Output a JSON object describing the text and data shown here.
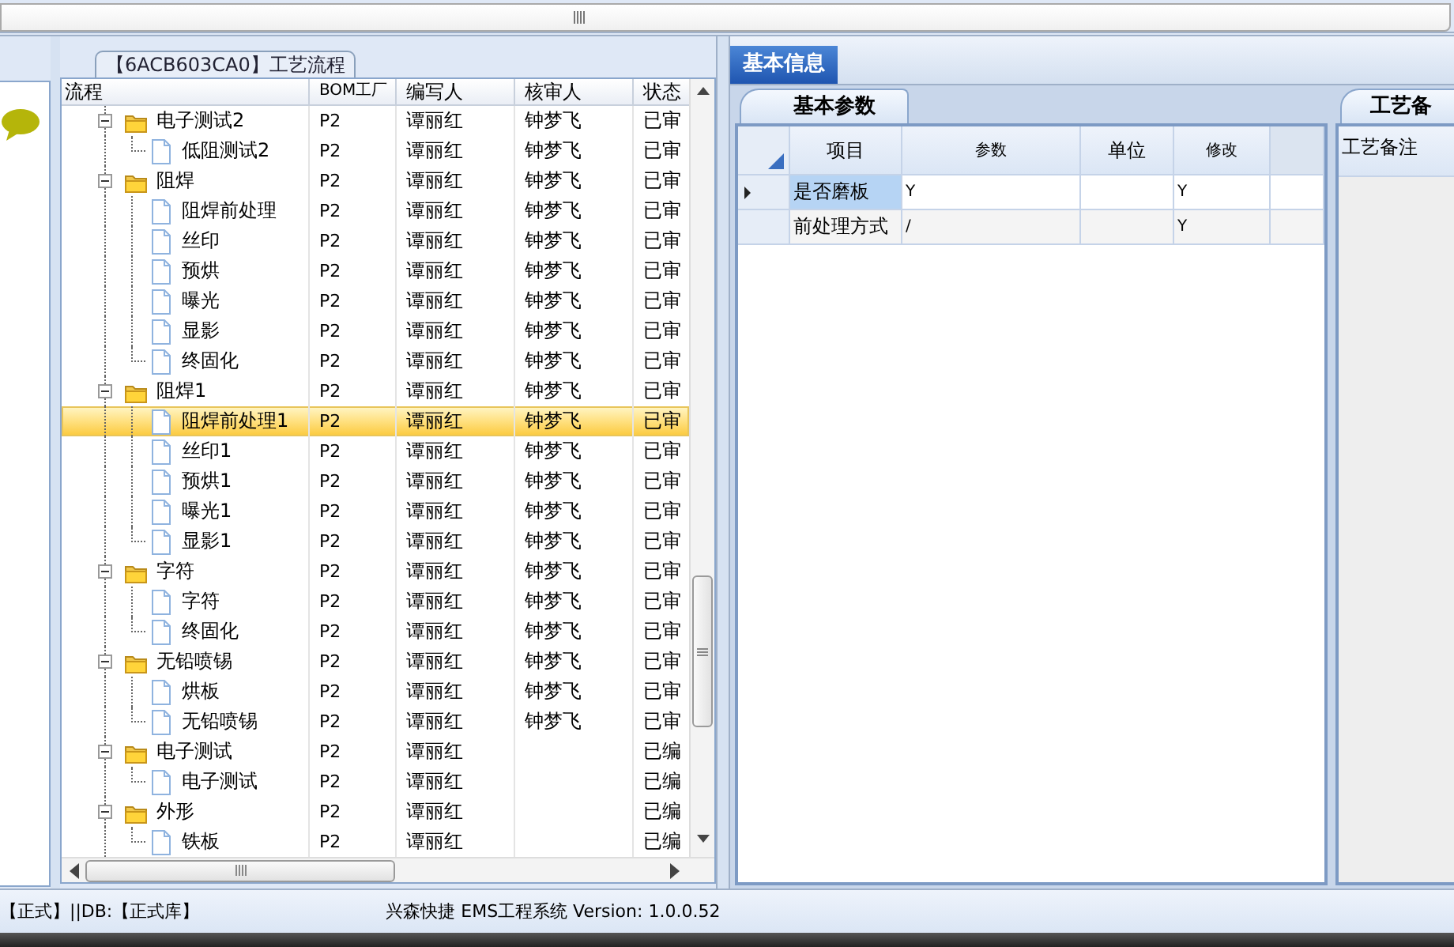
{
  "flow_panel": {
    "title": "【6ACB603CA0】工艺流程",
    "columns": [
      "流程",
      "BOM工厂",
      "编写人",
      "核审人",
      "状态"
    ],
    "rows": [
      {
        "label": "电子测试2",
        "bom": "P2",
        "writer": "谭丽红",
        "reviewer": "钟梦飞",
        "status": "已审",
        "expanded": true,
        "selected": false,
        "children": [
          {
            "label": "低阻测试2",
            "bom": "P2",
            "writer": "谭丽红",
            "reviewer": "钟梦飞",
            "status": "已审",
            "selected": false
          }
        ]
      },
      {
        "label": "阻焊",
        "bom": "P2",
        "writer": "谭丽红",
        "reviewer": "钟梦飞",
        "status": "已审",
        "expanded": true,
        "selected": false,
        "children": [
          {
            "label": "阻焊前处理",
            "bom": "P2",
            "writer": "谭丽红",
            "reviewer": "钟梦飞",
            "status": "已审",
            "selected": false
          },
          {
            "label": "丝印",
            "bom": "P2",
            "writer": "谭丽红",
            "reviewer": "钟梦飞",
            "status": "已审",
            "selected": false
          },
          {
            "label": "预烘",
            "bom": "P2",
            "writer": "谭丽红",
            "reviewer": "钟梦飞",
            "status": "已审",
            "selected": false
          },
          {
            "label": "曝光",
            "bom": "P2",
            "writer": "谭丽红",
            "reviewer": "钟梦飞",
            "status": "已审",
            "selected": false
          },
          {
            "label": "显影",
            "bom": "P2",
            "writer": "谭丽红",
            "reviewer": "钟梦飞",
            "status": "已审",
            "selected": false
          },
          {
            "label": "终固化",
            "bom": "P2",
            "writer": "谭丽红",
            "reviewer": "钟梦飞",
            "status": "已审",
            "selected": false
          }
        ]
      },
      {
        "label": "阻焊1",
        "bom": "P2",
        "writer": "谭丽红",
        "reviewer": "钟梦飞",
        "status": "已审",
        "expanded": true,
        "selected": false,
        "children": [
          {
            "label": "阻焊前处理1",
            "bom": "P2",
            "writer": "谭丽红",
            "reviewer": "钟梦飞",
            "status": "已审",
            "selected": true
          },
          {
            "label": "丝印1",
            "bom": "P2",
            "writer": "谭丽红",
            "reviewer": "钟梦飞",
            "status": "已审",
            "selected": false
          },
          {
            "label": "预烘1",
            "bom": "P2",
            "writer": "谭丽红",
            "reviewer": "钟梦飞",
            "status": "已审",
            "selected": false
          },
          {
            "label": "曝光1",
            "bom": "P2",
            "writer": "谭丽红",
            "reviewer": "钟梦飞",
            "status": "已审",
            "selected": false
          },
          {
            "label": "显影1",
            "bom": "P2",
            "writer": "谭丽红",
            "reviewer": "钟梦飞",
            "status": "已审",
            "selected": false
          }
        ]
      },
      {
        "label": "字符",
        "bom": "P2",
        "writer": "谭丽红",
        "reviewer": "钟梦飞",
        "status": "已审",
        "expanded": true,
        "selected": false,
        "children": [
          {
            "label": "字符",
            "bom": "P2",
            "writer": "谭丽红",
            "reviewer": "钟梦飞",
            "status": "已审",
            "selected": false
          },
          {
            "label": "终固化",
            "bom": "P2",
            "writer": "谭丽红",
            "reviewer": "钟梦飞",
            "status": "已审",
            "selected": false
          }
        ]
      },
      {
        "label": "无铅喷锡",
        "bom": "P2",
        "writer": "谭丽红",
        "reviewer": "钟梦飞",
        "status": "已审",
        "expanded": true,
        "selected": false,
        "children": [
          {
            "label": "烘板",
            "bom": "P2",
            "writer": "谭丽红",
            "reviewer": "钟梦飞",
            "status": "已审",
            "selected": false
          },
          {
            "label": "无铅喷锡",
            "bom": "P2",
            "writer": "谭丽红",
            "reviewer": "钟梦飞",
            "status": "已审",
            "selected": false
          }
        ]
      },
      {
        "label": "电子测试",
        "bom": "P2",
        "writer": "谭丽红",
        "status": "已编",
        "expanded": true,
        "selected": false,
        "children": [
          {
            "label": "电子测试",
            "bom": "P2",
            "writer": "谭丽红",
            "status": "已编",
            "selected": false
          }
        ]
      },
      {
        "label": "外形",
        "bom": "P2",
        "writer": "谭丽红",
        "status": "已编",
        "expanded": true,
        "selected": false,
        "children": [
          {
            "label": "铁板",
            "bom": "P2",
            "writer": "谭丽红",
            "status": "已编",
            "selected": false
          }
        ]
      }
    ]
  },
  "info_tabs": [
    {
      "label": "基本信息",
      "selected": true
    }
  ],
  "param_panel": {
    "tab": "基本参数",
    "columns": [
      "项目",
      "参数",
      "单位",
      "修改"
    ],
    "rows": [
      {
        "item": "是否磨板",
        "param": "Y",
        "modify": "Y",
        "selected": true
      },
      {
        "item": "前处理方式",
        "param": "/",
        "modify": "Y",
        "selected": false
      }
    ]
  },
  "remark_panel": {
    "tab": "工艺备",
    "label": "工艺备注"
  },
  "status_bar": {
    "left": "【正式】||DB:【正式库】",
    "right": "兴森快捷 EMS工程系统 Version: 1.0.0.52"
  }
}
